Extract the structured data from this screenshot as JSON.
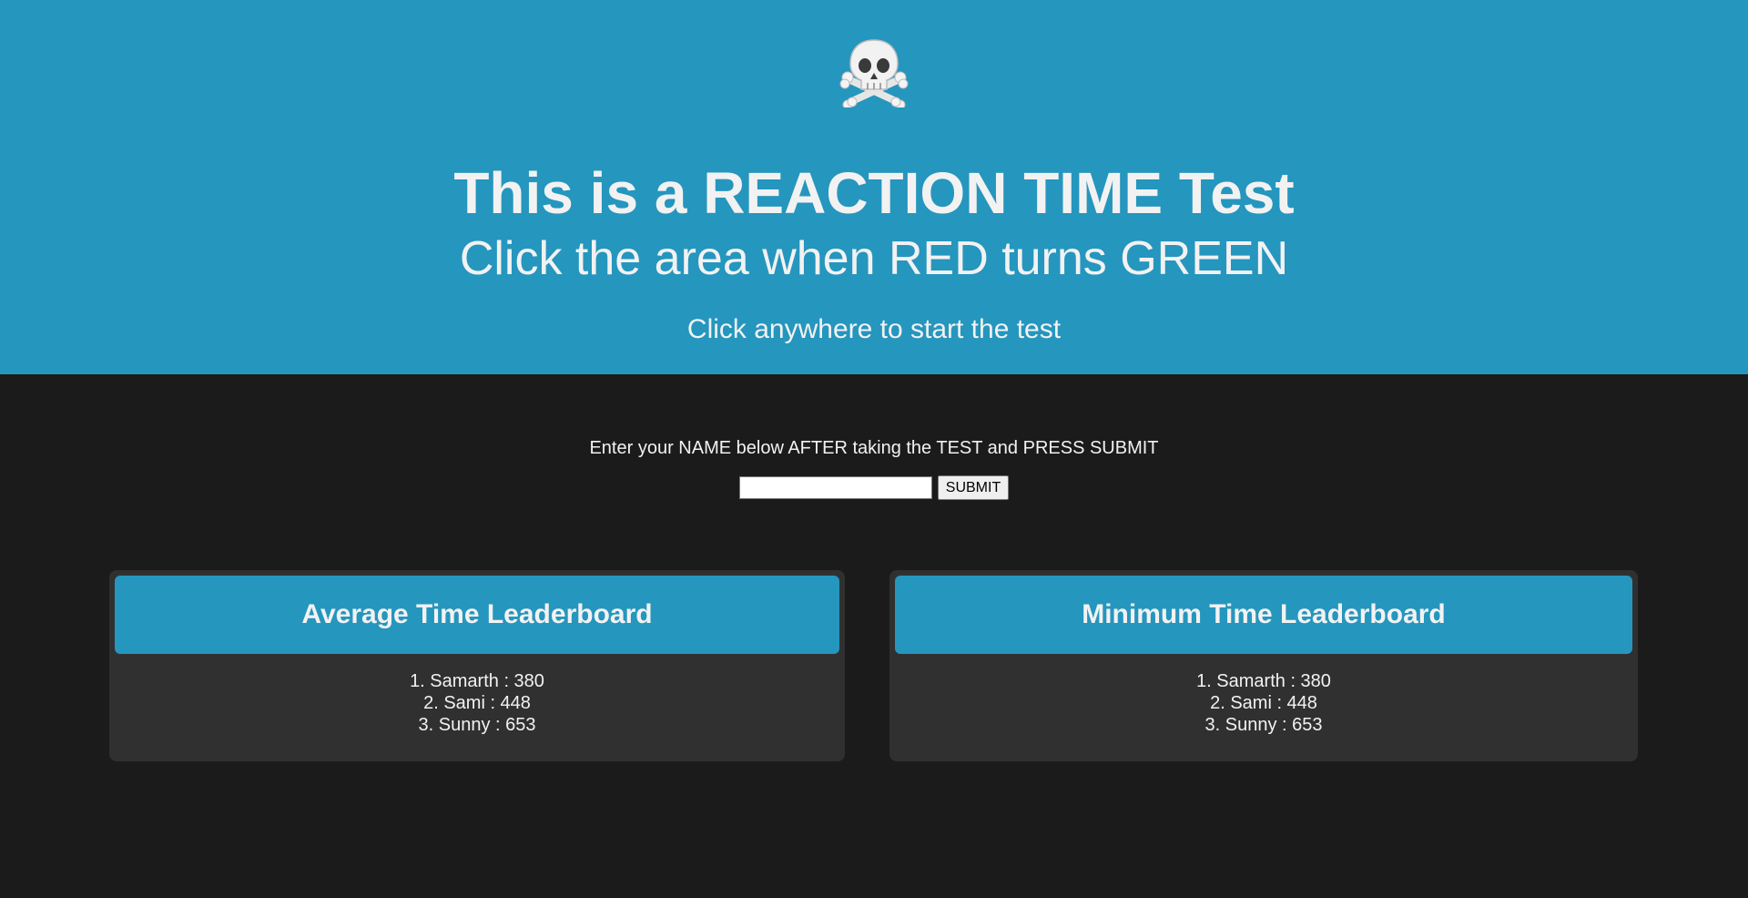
{
  "hero": {
    "icon": "skull-crossbones-icon",
    "title": "This is a REACTION TIME Test",
    "subtitle": "Click the area when RED turns GREEN",
    "hint": "Click anywhere to start the test"
  },
  "submit": {
    "instructions": "Enter your NAME below AFTER taking the TEST and PRESS SUBMIT",
    "name_value": "",
    "button_label": "SUBMIT"
  },
  "leaderboards": {
    "average": {
      "title": "Average Time Leaderboard",
      "entries": [
        "1. Samarth : 380",
        "2. Sami : 448",
        "3. Sunny : 653"
      ]
    },
    "minimum": {
      "title": "Minimum Time Leaderboard",
      "entries": [
        "1. Samarth : 380",
        "2. Sami : 448",
        "3. Sunny : 653"
      ]
    }
  },
  "colors": {
    "accent_blue": "#2596be",
    "page_background": "#1b1b1b",
    "card_background": "#303030",
    "text": "#f2f2f2"
  }
}
